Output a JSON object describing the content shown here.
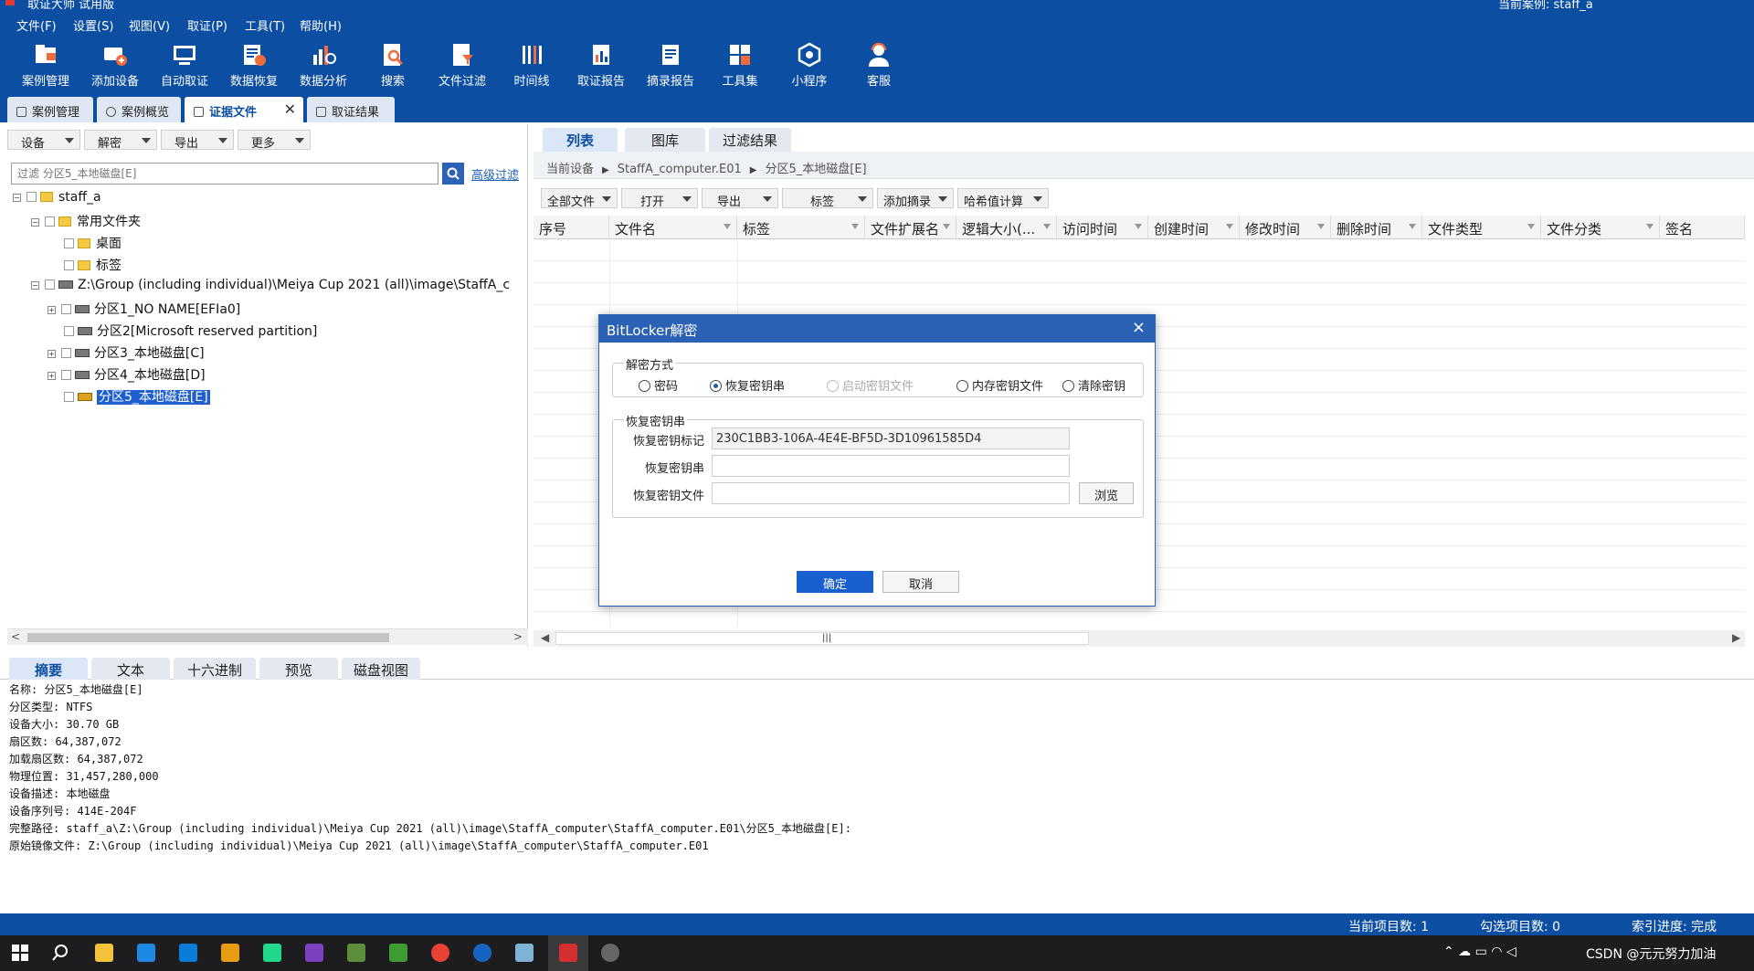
{
  "window": {
    "title": "取证大师 试用版",
    "current_case": "当前案例: staff_a"
  },
  "menu": [
    "文件(F)",
    "设置(S)",
    "视图(V)",
    "取证(P)",
    "工具(T)",
    "帮助(H)"
  ],
  "toolbar": [
    {
      "label": "案例管理",
      "icon": "case-manage-icon"
    },
    {
      "label": "添加设备",
      "icon": "add-device-icon"
    },
    {
      "label": "自动取证",
      "icon": "auto-forensic-icon"
    },
    {
      "label": "数据恢复",
      "icon": "data-recovery-icon"
    },
    {
      "label": "数据分析",
      "icon": "data-analysis-icon"
    },
    {
      "label": "搜索",
      "icon": "search-icon"
    },
    {
      "label": "文件过滤",
      "icon": "file-filter-icon"
    },
    {
      "label": "时间线",
      "icon": "timeline-icon"
    },
    {
      "label": "取证报告",
      "icon": "report-icon"
    },
    {
      "label": "摘录报告",
      "icon": "excerpt-report-icon"
    },
    {
      "label": "工具集",
      "icon": "toolkit-icon"
    },
    {
      "label": "小程序",
      "icon": "miniapp-icon"
    },
    {
      "label": "客服",
      "icon": "support-icon"
    }
  ],
  "main_tabs": [
    "案例管理",
    "案例概览",
    "证据文件",
    "取证结果"
  ],
  "active_main_tab": "证据文件",
  "left_toolbar": [
    "设备",
    "解密",
    "导出",
    "更多"
  ],
  "filter": {
    "placeholder": "过滤 分区5_本地磁盘[E]",
    "advanced": "高级过滤"
  },
  "tree": [
    {
      "label": "staff_a",
      "level": 0,
      "expander": "−",
      "icon": "folder"
    },
    {
      "label": "常用文件夹",
      "level": 1,
      "expander": "−",
      "icon": "folder"
    },
    {
      "label": "桌面",
      "level": 2,
      "expander": "",
      "icon": "folder"
    },
    {
      "label": "标签",
      "level": 2,
      "expander": "",
      "icon": "folder"
    },
    {
      "label": "Z:\\Group (including individual)\\Meiya Cup 2021 (all)\\image\\StaffA_c",
      "level": 1,
      "expander": "−",
      "icon": "disk"
    },
    {
      "label": "分区1_NO NAME[EFIa0]",
      "level": 2,
      "expander": "+",
      "icon": "disk"
    },
    {
      "label": "分区2[Microsoft reserved partition]",
      "level": 2,
      "expander": "",
      "icon": "disk"
    },
    {
      "label": "分区3_本地磁盘[C]",
      "level": 2,
      "expander": "+",
      "icon": "disk"
    },
    {
      "label": "分区4_本地磁盘[D]",
      "level": 2,
      "expander": "+",
      "icon": "disk"
    },
    {
      "label": "分区5_本地磁盘[E]",
      "level": 2,
      "expander": "",
      "icon": "locked-disk",
      "selected": true
    }
  ],
  "right_tabs": [
    "列表",
    "图库",
    "过滤结果"
  ],
  "breadcrumb": [
    "当前设备",
    "StaffA_computer.E01",
    "分区5_本地磁盘[E]"
  ],
  "right_toolbar": [
    "全部文件",
    "打开",
    "导出",
    "标签",
    "添加摘录",
    "哈希值计算"
  ],
  "grid_columns": [
    "序号",
    "文件名",
    "标签",
    "文件扩展名",
    "逻辑大小(...",
    "访问时间",
    "创建时间",
    "修改时间",
    "删除时间",
    "文件类型",
    "文件分类",
    "签名"
  ],
  "bottom_tabs": [
    "摘要",
    "文本",
    "十六进制",
    "预览",
    "磁盘视图"
  ],
  "summary_lines": [
    "名称: 分区5_本地磁盘[E]",
    "分区类型: NTFS",
    "设备大小: 30.70 GB",
    "扇区数: 64,387,072",
    "加载扇区数: 64,387,072",
    "物理位置: 31,457,280,000",
    "设备描述: 本地磁盘",
    "设备序列号: 414E-204F",
    "完整路径: staff_a\\Z:\\Group (including individual)\\Meiya Cup 2021 (all)\\image\\StaffA_computer\\StaffA_computer.E01\\分区5_本地磁盘[E]:",
    "原始镜像文件: Z:\\Group (including individual)\\Meiya Cup 2021 (all)\\image\\StaffA_computer\\StaffA_computer.E01"
  ],
  "status": {
    "current_count": "当前项目数: 1",
    "checked_count": "勾选项目数: 0",
    "index_progress": "索引进度: 完成"
  },
  "tray_text": "CSDN @元元努力加油",
  "dialog": {
    "title": "BitLocker解密",
    "close": "×",
    "method_group": "解密方式",
    "methods": [
      {
        "label": "密码",
        "checked": false,
        "disabled": false
      },
      {
        "label": "恢复密钥串",
        "checked": true,
        "disabled": false
      },
      {
        "label": "启动密钥文件",
        "checked": false,
        "disabled": true
      },
      {
        "label": "内存密钥文件",
        "checked": false,
        "disabled": false
      },
      {
        "label": "清除密钥",
        "checked": false,
        "disabled": false
      }
    ],
    "key_group": "恢复密钥串",
    "id_label": "恢复密钥标记",
    "id_value": "230C1BB3-106A-4E4E-BF5D-3D10961585D4",
    "key_label": "恢复密钥串",
    "key_value": "",
    "file_label": "恢复密钥文件",
    "file_value": "",
    "browse": "浏览",
    "ok": "确定",
    "cancel": "取消"
  }
}
